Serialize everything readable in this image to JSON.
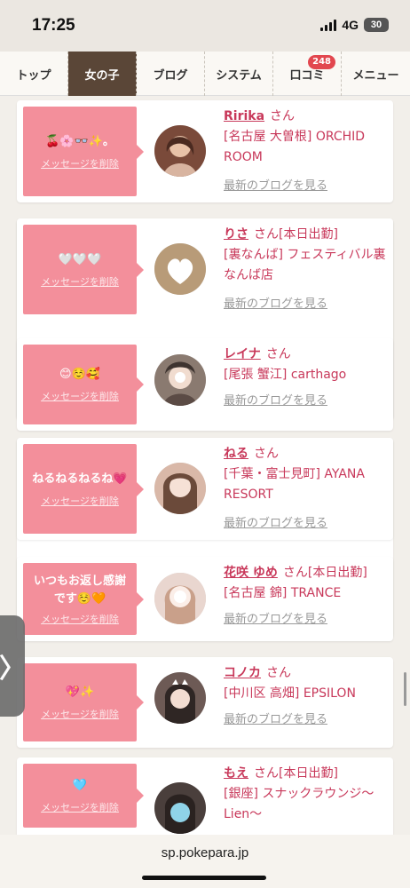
{
  "status": {
    "time": "17:25",
    "network": "4G",
    "battery": "30"
  },
  "nav": {
    "items": [
      {
        "label": "トップ"
      },
      {
        "label": "女の子"
      },
      {
        "label": "ブログ"
      },
      {
        "label": "システム"
      },
      {
        "label": "口コミ",
        "badge": "248"
      },
      {
        "label": "メニュー"
      }
    ]
  },
  "cards": [
    {
      "message": "🍒🌸👓✨。",
      "delete_label": "メッセージを削除",
      "name": "Ririka",
      "honorific": "さん",
      "tag": "",
      "shop": "[名古屋 大曽根] ORCHID ROOM",
      "blog_link": "最新のブログを見る",
      "avatar_color": "#7a4a3a"
    },
    {
      "message": "🤍🤍🤍",
      "delete_label": "メッセージを削除",
      "name": "りさ",
      "honorific": "さん",
      "tag": "[本日出勤]",
      "shop": "[裏なんば] フェスティバル裏なんば店",
      "blog_link": "最新のブログを見る",
      "avatar_color": "#b89b78"
    },
    {
      "message": "😊☺️🥰",
      "delete_label": "メッセージを削除",
      "name": "レイナ",
      "honorific": "さん",
      "tag": "",
      "shop": "[尾張 蟹江] carthago",
      "blog_link": "最新のブログを見る",
      "avatar_color": "#8a7a70"
    },
    {
      "message": "ねるねるねるね💗",
      "delete_label": "メッセージを削除",
      "name": "ねる",
      "honorific": "さん",
      "tag": "",
      "shop": "[千葉・富士見町] AYANA RESORT",
      "blog_link": "最新のブログを見る",
      "avatar_color": "#d9b8a8"
    },
    {
      "message": "いつもお返し感謝です☺️🧡",
      "delete_label": "メッセージを削除",
      "name": "花咲 ゆめ",
      "honorific": "さん",
      "tag": "[本日出勤]",
      "shop": "[名古屋 錦] TRANCE",
      "blog_link": "最新のブログを見る",
      "avatar_color": "#e9d6cf"
    },
    {
      "message": "💖✨",
      "delete_label": "メッセージを削除",
      "name": "コノカ",
      "honorific": "さん",
      "tag": "",
      "shop": "[中川区 高畑] EPSILON",
      "blog_link": "最新のブログを見る",
      "avatar_color": "#6d5a55"
    },
    {
      "message": "🩵",
      "delete_label": "メッセージを削除",
      "name": "もえ",
      "honorific": "さん",
      "tag": "[本日出勤]",
      "shop": "[銀座] スナックラウンジ〜Lien〜",
      "blog_link": "",
      "avatar_color": "#4a3f3c"
    }
  ],
  "drawer_toggle": {
    "label": "〉"
  },
  "url_bar": {
    "url": "sp.pokepara.jp"
  }
}
